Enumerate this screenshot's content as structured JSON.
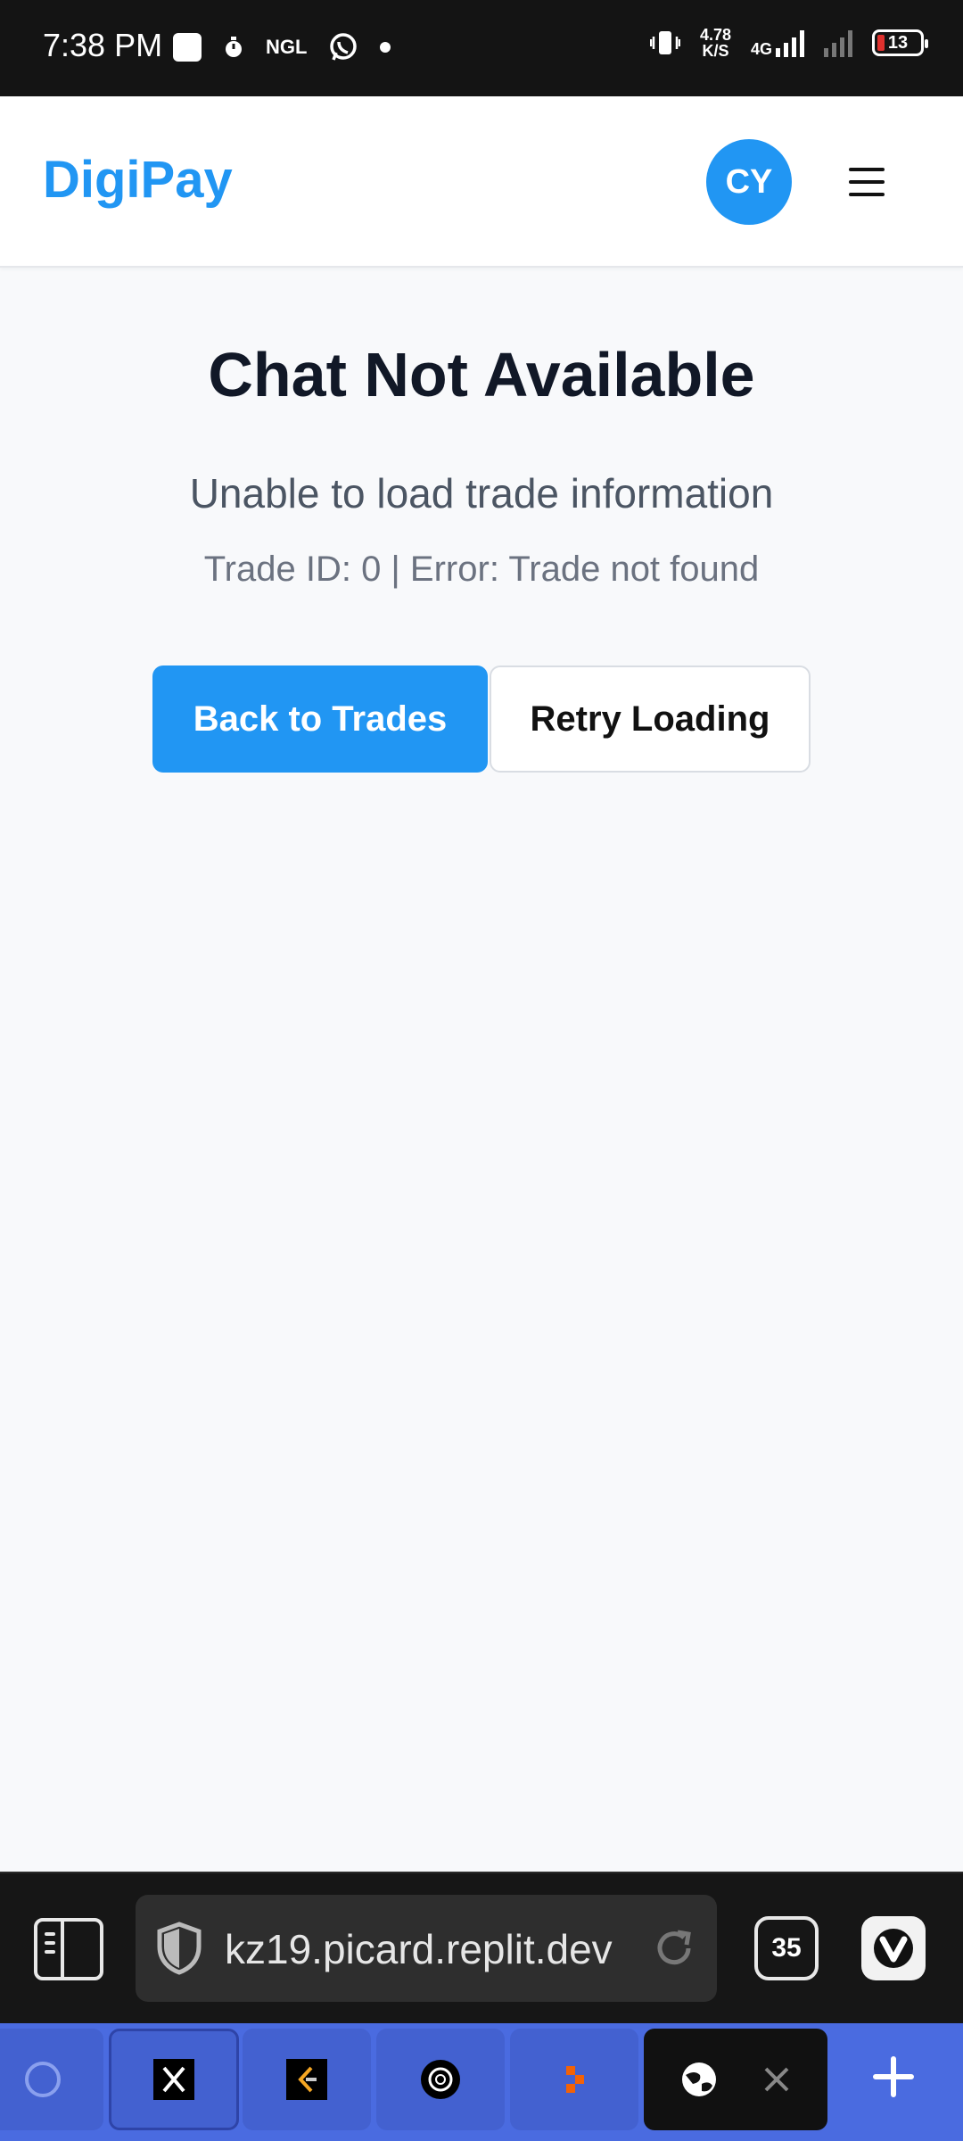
{
  "status_bar": {
    "time": "7:38 PM",
    "network_speed": "4.78",
    "network_unit": "K/S",
    "network_type": "4G",
    "battery": "13",
    "notification_icons": [
      "square-icon",
      "stopwatch-icon",
      "ngl-icon",
      "whatsapp-icon",
      "dot-icon"
    ]
  },
  "header": {
    "brand": "DigiPay",
    "avatar_initials": "CY",
    "brand_color": "#2196f3"
  },
  "main": {
    "title": "Chat Not Available",
    "subtitle": "Unable to load trade information",
    "detail": "Trade ID: 0 | Error: Trade not found",
    "primary_button": "Back to Trades",
    "secondary_button": "Retry Loading"
  },
  "browser": {
    "url": "kz19.picard.replit.dev",
    "tab_count": "35",
    "tabs": [
      {
        "icon": "globe-icon"
      },
      {
        "icon": "x-logo-icon",
        "active": true
      },
      {
        "icon": "leetcode-icon"
      },
      {
        "icon": "openai-icon"
      },
      {
        "icon": "replit-icon"
      },
      {
        "icon": "globe-icon",
        "current": true
      }
    ]
  }
}
